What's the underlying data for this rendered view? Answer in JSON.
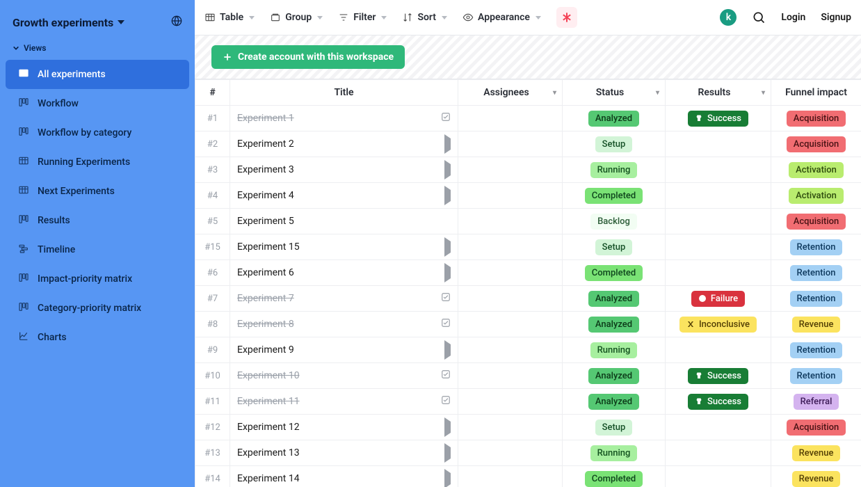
{
  "workspace": {
    "title": "Growth experiments",
    "avatar_letter": "k"
  },
  "sidebar": {
    "views_label": "Views",
    "items": [
      {
        "label": "All experiments",
        "icon": "grid"
      },
      {
        "label": "Workflow",
        "icon": "kanban"
      },
      {
        "label": "Workflow by category",
        "icon": "kanban"
      },
      {
        "label": "Running Experiments",
        "icon": "grid"
      },
      {
        "label": "Next Experiments",
        "icon": "grid"
      },
      {
        "label": "Results",
        "icon": "kanban"
      },
      {
        "label": "Timeline",
        "icon": "timeline"
      },
      {
        "label": "Impact-priority matrix",
        "icon": "kanban"
      },
      {
        "label": "Category-priority matrix",
        "icon": "kanban"
      },
      {
        "label": "Charts",
        "icon": "chart"
      }
    ]
  },
  "toolbar": {
    "table": "Table",
    "group": "Group",
    "filter": "Filter",
    "sort": "Sort",
    "appearance": "Appearance",
    "login": "Login",
    "signup": "Signup"
  },
  "actionbar": {
    "create_label": "Create account with this workspace"
  },
  "table": {
    "columns": {
      "idx": "#",
      "title": "Title",
      "assignees": "Assignees",
      "status": "Status",
      "results": "Results",
      "funnel": "Funnel impact"
    },
    "rows": [
      {
        "idx": "#1",
        "title": "Experiment 1",
        "done": true,
        "status": "Analyzed",
        "status_cls": "analyzed",
        "result": "Success",
        "result_cls": "success",
        "funnel": "Acquisition",
        "funnel_cls": "acquisition"
      },
      {
        "idx": "#2",
        "title": "Experiment 2",
        "done": false,
        "status": "Setup",
        "status_cls": "setup",
        "result": "",
        "result_cls": "",
        "funnel": "Acquisition",
        "funnel_cls": "acquisition"
      },
      {
        "idx": "#3",
        "title": "Experiment 3",
        "done": false,
        "status": "Running",
        "status_cls": "running",
        "result": "",
        "result_cls": "",
        "funnel": "Activation",
        "funnel_cls": "activation"
      },
      {
        "idx": "#4",
        "title": "Experiment 4",
        "done": false,
        "status": "Completed",
        "status_cls": "completed",
        "result": "",
        "result_cls": "",
        "funnel": "Activation",
        "funnel_cls": "activation"
      },
      {
        "idx": "#5",
        "title": "Experiment 5",
        "done": false,
        "status": "Backlog",
        "status_cls": "backlog",
        "result": "",
        "result_cls": "",
        "funnel": "Acquisition",
        "funnel_cls": "acquisition",
        "no_action": true
      },
      {
        "idx": "#15",
        "title": "Experiment 15",
        "done": false,
        "status": "Setup",
        "status_cls": "setup",
        "result": "",
        "result_cls": "",
        "funnel": "Retention",
        "funnel_cls": "retention"
      },
      {
        "idx": "#6",
        "title": "Experiment 6",
        "done": false,
        "status": "Completed",
        "status_cls": "completed",
        "result": "",
        "result_cls": "",
        "funnel": "Retention",
        "funnel_cls": "retention"
      },
      {
        "idx": "#7",
        "title": "Experiment 7",
        "done": true,
        "status": "Analyzed",
        "status_cls": "analyzed",
        "result": "Failure",
        "result_cls": "failure",
        "funnel": "Retention",
        "funnel_cls": "retention"
      },
      {
        "idx": "#8",
        "title": "Experiment 8",
        "done": true,
        "status": "Analyzed",
        "status_cls": "analyzed",
        "result": "Inconclusive",
        "result_cls": "inconclusive",
        "funnel": "Revenue",
        "funnel_cls": "revenue"
      },
      {
        "idx": "#9",
        "title": "Experiment 9",
        "done": false,
        "status": "Running",
        "status_cls": "running",
        "result": "",
        "result_cls": "",
        "funnel": "Retention",
        "funnel_cls": "retention"
      },
      {
        "idx": "#10",
        "title": "Experiment 10",
        "done": true,
        "status": "Analyzed",
        "status_cls": "analyzed",
        "result": "Success",
        "result_cls": "success",
        "funnel": "Retention",
        "funnel_cls": "retention"
      },
      {
        "idx": "#11",
        "title": "Experiment 11",
        "done": true,
        "status": "Analyzed",
        "status_cls": "analyzed",
        "result": "Success",
        "result_cls": "success",
        "funnel": "Referral",
        "funnel_cls": "referral"
      },
      {
        "idx": "#12",
        "title": "Experiment 12",
        "done": false,
        "status": "Setup",
        "status_cls": "setup",
        "result": "",
        "result_cls": "",
        "funnel": "Acquisition",
        "funnel_cls": "acquisition"
      },
      {
        "idx": "#13",
        "title": "Experiment 13",
        "done": false,
        "status": "Running",
        "status_cls": "running",
        "result": "",
        "result_cls": "",
        "funnel": "Revenue",
        "funnel_cls": "revenue"
      },
      {
        "idx": "#14",
        "title": "Experiment 14",
        "done": false,
        "status": "Completed",
        "status_cls": "completed",
        "result": "",
        "result_cls": "",
        "funnel": "Revenue",
        "funnel_cls": "revenue"
      }
    ]
  }
}
